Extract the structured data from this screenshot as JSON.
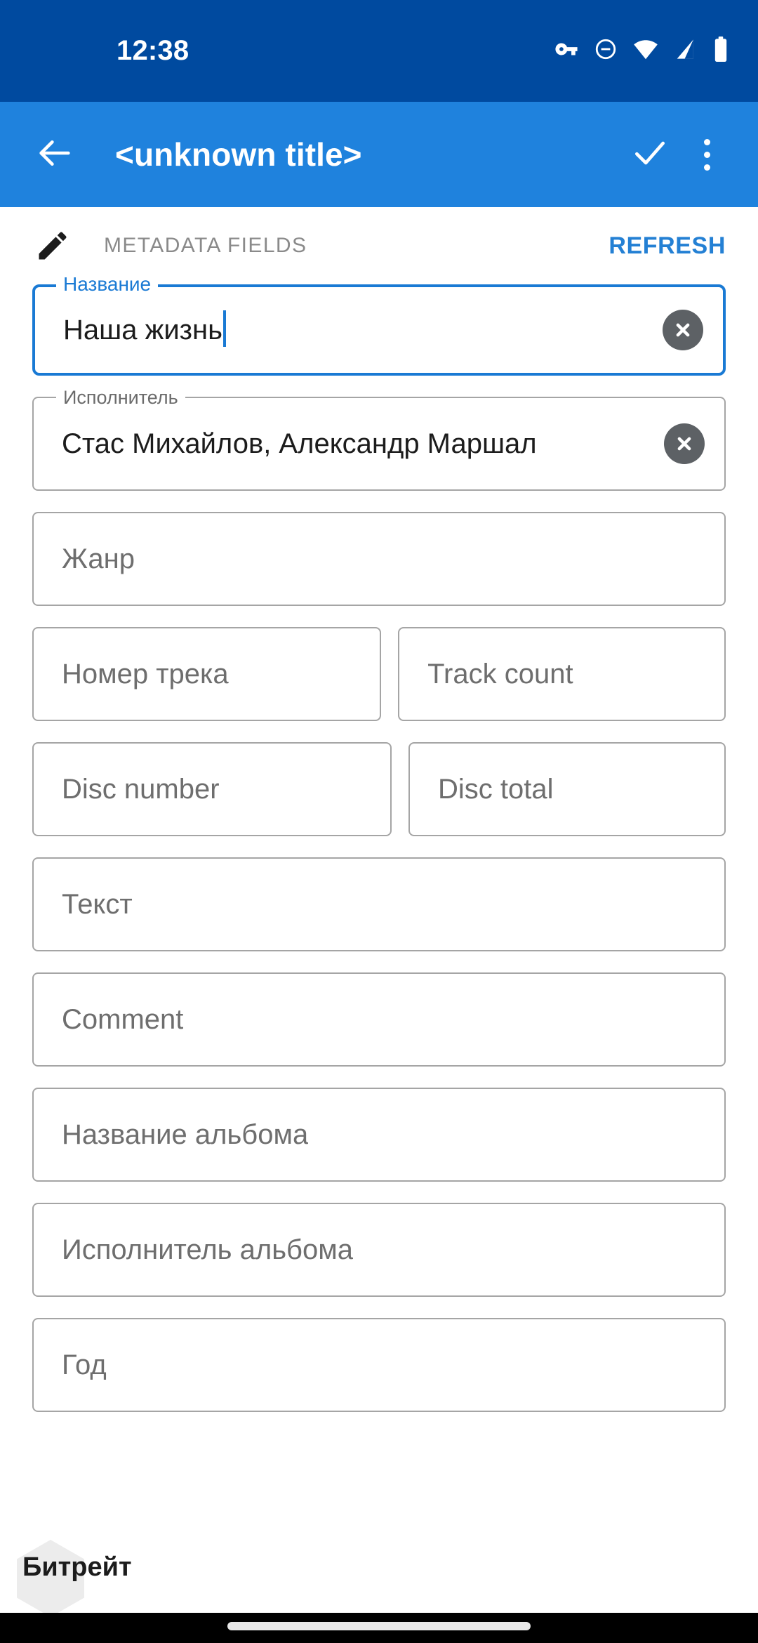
{
  "status_bar": {
    "time": "12:38",
    "background": "#004a9f",
    "icons": [
      "vpn-key-icon",
      "do-not-disturb-icon",
      "wifi-icon",
      "cellular-signal-icon",
      "battery-icon"
    ]
  },
  "app_bar": {
    "background": "#1f82dd",
    "title": "<unknown title>",
    "back_icon": "arrow-back-icon",
    "confirm_icon": "check-icon",
    "overflow_icon": "more-vert-icon"
  },
  "section": {
    "icon": "pencil-edit-icon",
    "label": "METADATA FIELDS",
    "action_label": "REFRESH",
    "action_color": "#2480d4"
  },
  "fields": [
    {
      "name": "title",
      "label": "Название",
      "value": "Наша жизнь",
      "placeholder": "",
      "focused": true,
      "has_clear": true
    },
    {
      "name": "artist",
      "label": "Исполнитель",
      "value": "Стас Михайлов, Александр Маршал",
      "placeholder": "",
      "focused": false,
      "has_clear": true
    },
    {
      "name": "genre",
      "label": "",
      "value": "",
      "placeholder": "Жанр",
      "focused": false,
      "has_clear": false
    },
    {
      "name": "track-number",
      "label": "",
      "value": "",
      "placeholder": "Номер трека",
      "focused": false,
      "has_clear": false
    },
    {
      "name": "track-count",
      "label": "",
      "value": "",
      "placeholder": "Track count",
      "focused": false,
      "has_clear": false
    },
    {
      "name": "disc-number",
      "label": "",
      "value": "",
      "placeholder": "Disc number",
      "focused": false,
      "has_clear": false
    },
    {
      "name": "disc-total",
      "label": "",
      "value": "",
      "placeholder": "Disc total",
      "focused": false,
      "has_clear": false
    },
    {
      "name": "lyrics",
      "label": "",
      "value": "",
      "placeholder": "Текст",
      "focused": false,
      "has_clear": false
    },
    {
      "name": "comment",
      "label": "",
      "value": "",
      "placeholder": "Comment",
      "focused": false,
      "has_clear": false
    },
    {
      "name": "album-title",
      "label": "",
      "value": "",
      "placeholder": "Название альбома",
      "focused": false,
      "has_clear": false
    },
    {
      "name": "album-artist",
      "label": "",
      "value": "",
      "placeholder": "Исполнитель альбома",
      "focused": false,
      "has_clear": false
    },
    {
      "name": "year",
      "label": "",
      "value": "",
      "placeholder": "Год",
      "focused": false,
      "has_clear": false
    }
  ],
  "bottom": {
    "next_field_label": "Битрейт",
    "scroll_thumb": "fast-scroll-thumb"
  },
  "colors": {
    "status_bar_bg": "#004a9f",
    "app_bar_bg": "#1f82dd",
    "accent": "#1a7ad4",
    "field_border": "#a5a5a5",
    "placeholder": "#6e6e6e",
    "clear_button": "#5d6165",
    "nav_bar_bg": "#000000"
  }
}
